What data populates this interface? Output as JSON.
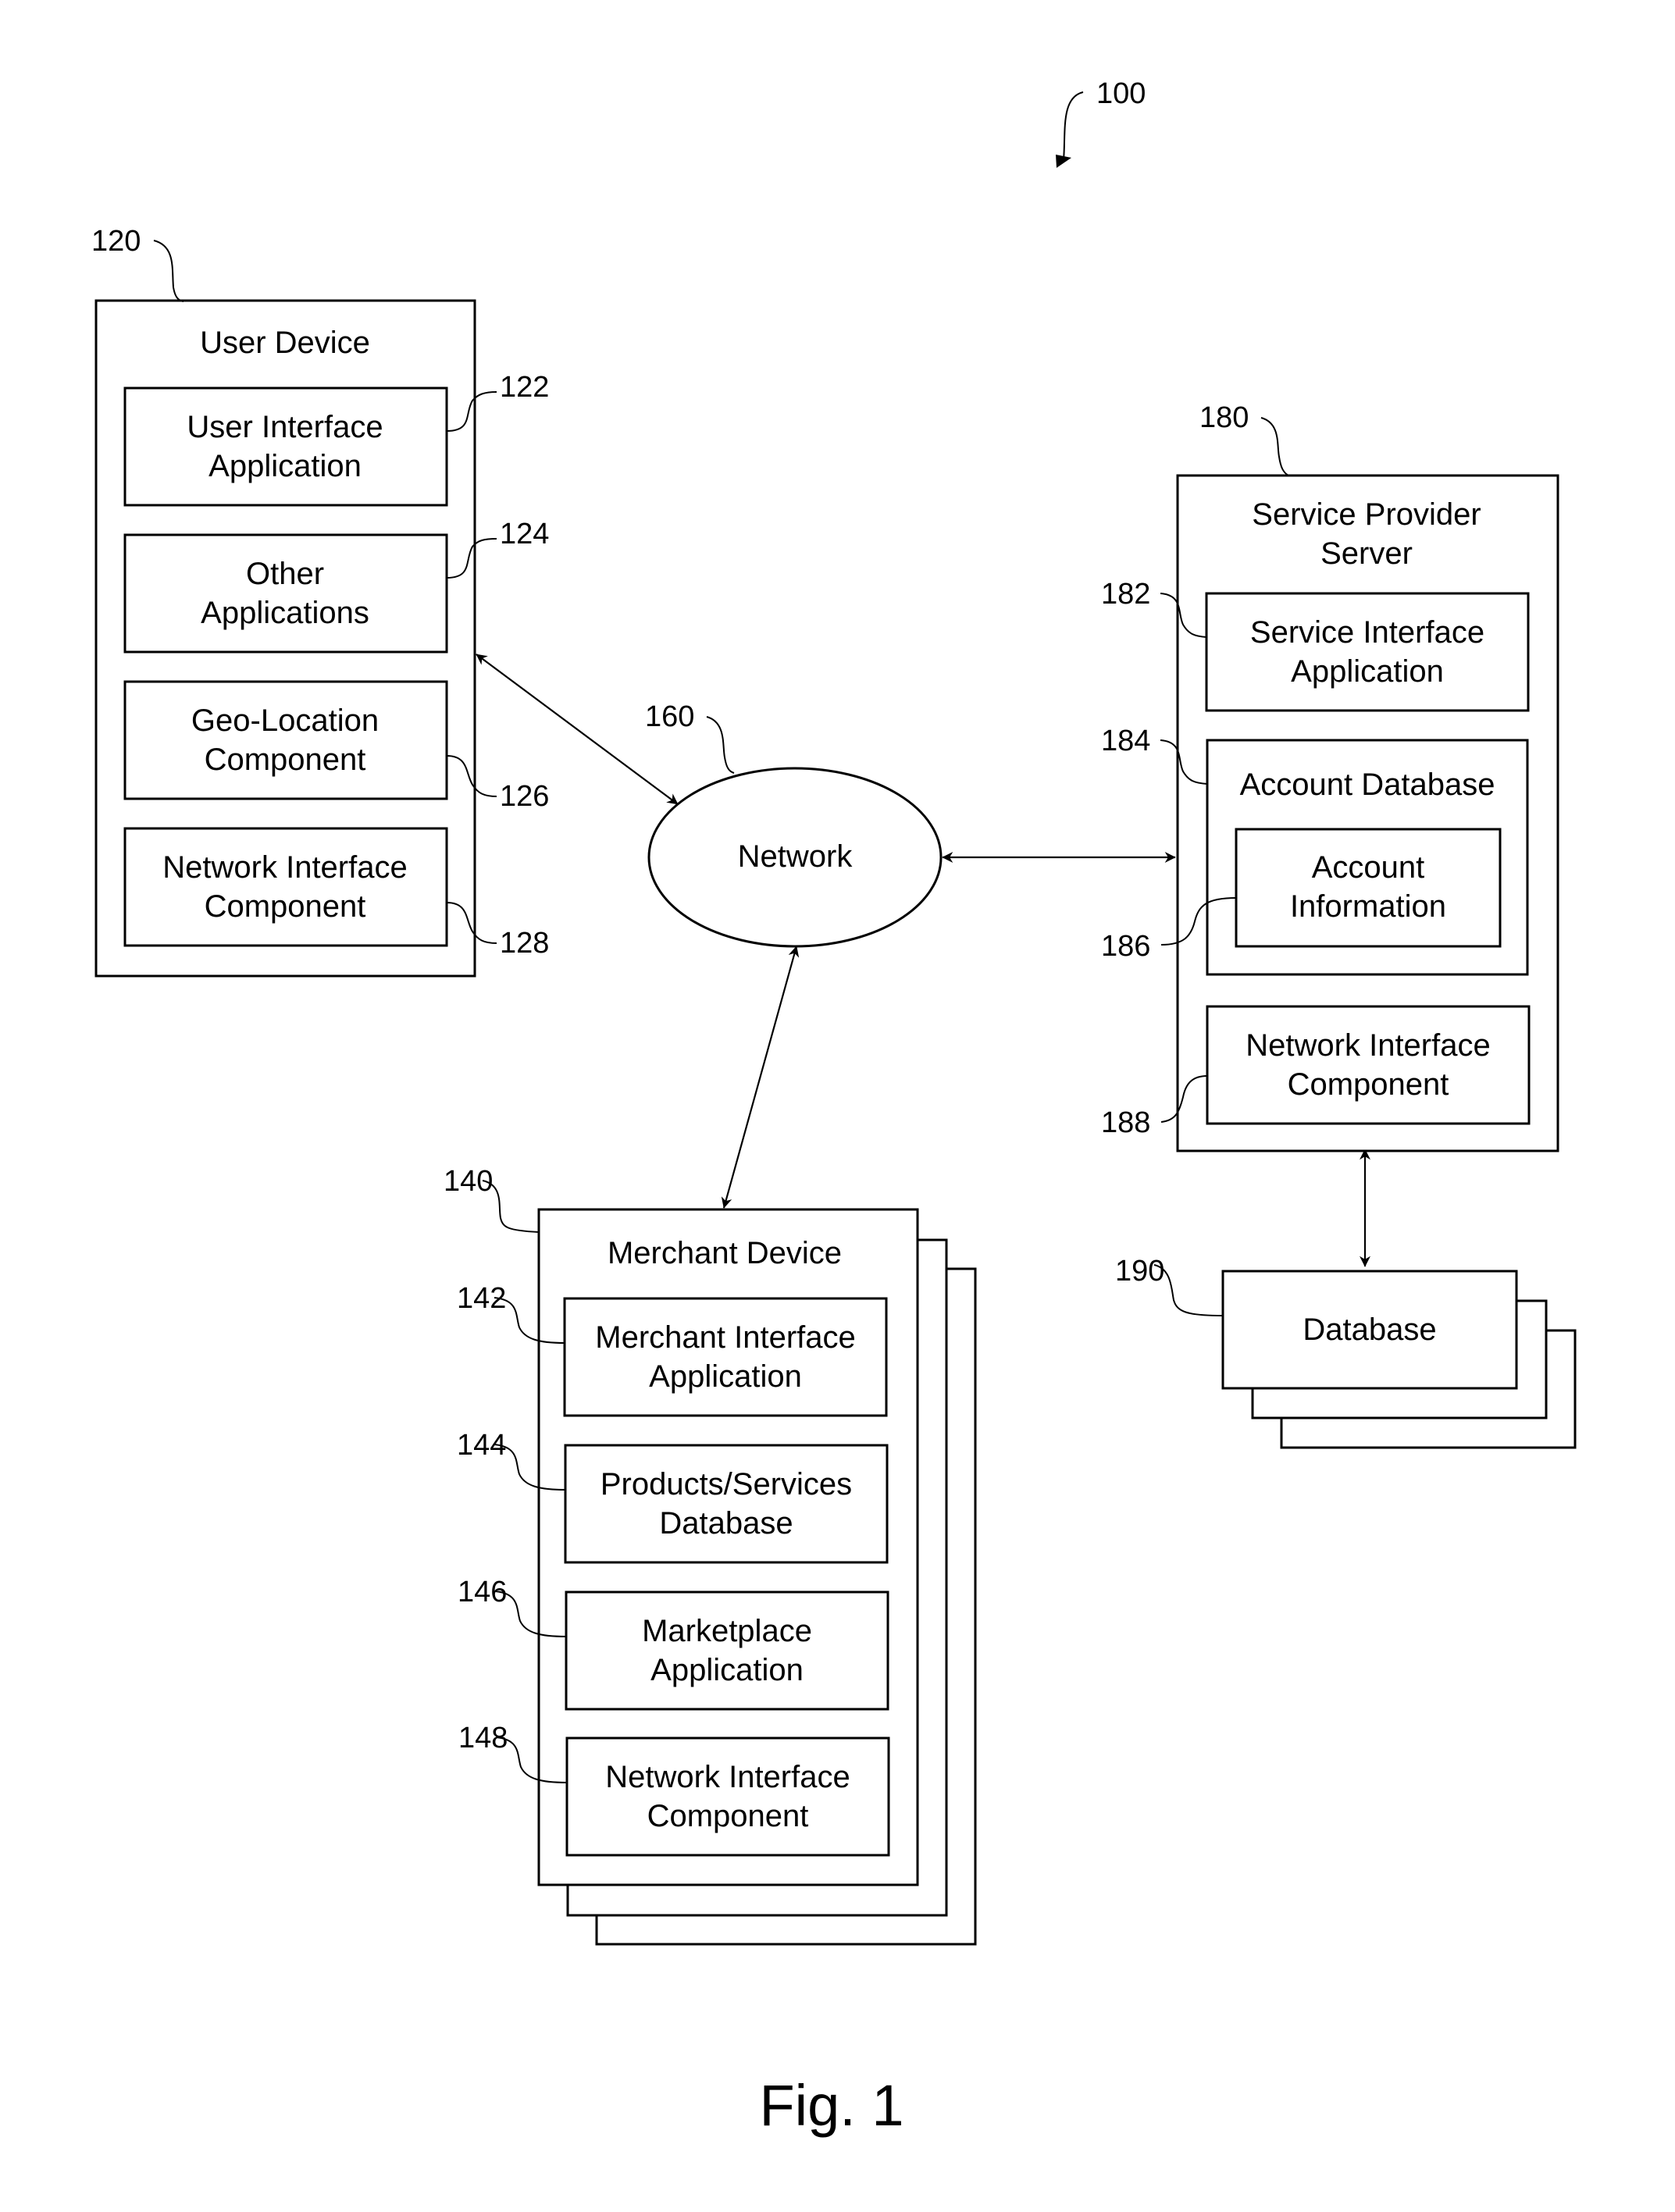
{
  "figure": {
    "caption": "Fig. 1",
    "system_ref": "100"
  },
  "user_device": {
    "ref": "120",
    "title": "User Device",
    "components": [
      {
        "ref": "122",
        "line1": "User Interface",
        "line2": "Application"
      },
      {
        "ref": "124",
        "line1": "Other",
        "line2": "Applications"
      },
      {
        "ref": "126",
        "line1": "Geo-Location",
        "line2": "Component"
      },
      {
        "ref": "128",
        "line1": "Network Interface",
        "line2": "Component"
      }
    ]
  },
  "network": {
    "ref": "160",
    "label": "Network"
  },
  "merchant_device": {
    "ref": "140",
    "title": "Merchant Device",
    "components": [
      {
        "ref": "142",
        "line1": "Merchant Interface",
        "line2": "Application"
      },
      {
        "ref": "144",
        "line1": "Products/Services",
        "line2": "Database"
      },
      {
        "ref": "146",
        "line1": "Marketplace",
        "line2": "Application"
      },
      {
        "ref": "148",
        "line1": "Network Interface",
        "line2": "Component"
      }
    ]
  },
  "service_provider_server": {
    "ref": "180",
    "title_line1": "Service Provider",
    "title_line2": "Server",
    "service_interface": {
      "ref": "182",
      "line1": "Service Interface",
      "line2": "Application"
    },
    "account_database": {
      "ref": "184",
      "title": "Account Database",
      "account_information": {
        "ref": "186",
        "line1": "Account",
        "line2": "Information"
      }
    },
    "network_interface": {
      "ref": "188",
      "line1": "Network Interface",
      "line2": "Component"
    }
  },
  "database": {
    "ref": "190",
    "label": "Database"
  },
  "connections": [
    {
      "from": "User Device",
      "to": "Network",
      "type": "bidirectional"
    },
    {
      "from": "Network",
      "to": "Service Provider Server",
      "type": "bidirectional"
    },
    {
      "from": "Network",
      "to": "Merchant Device",
      "type": "bidirectional"
    },
    {
      "from": "Service Provider Server",
      "to": "Database",
      "type": "bidirectional"
    }
  ]
}
